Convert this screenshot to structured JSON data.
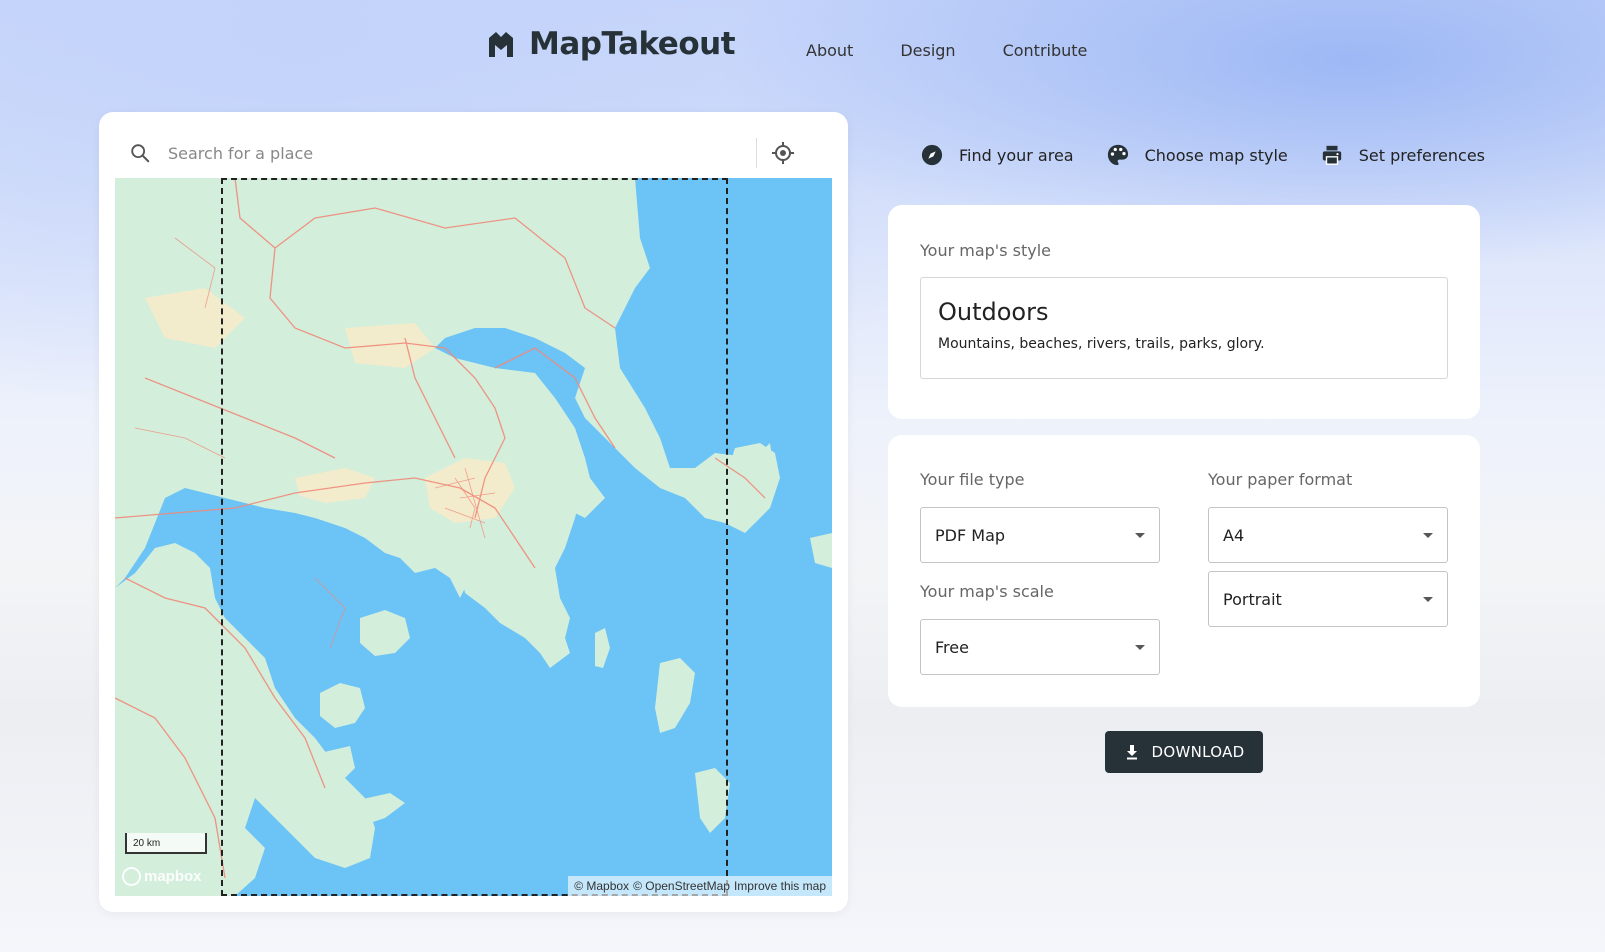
{
  "app": {
    "name": "MapTakeout"
  },
  "nav": [
    {
      "label": "About"
    },
    {
      "label": "Design"
    },
    {
      "label": "Contribute"
    }
  ],
  "search": {
    "placeholder": "Search for a place",
    "value": ""
  },
  "map": {
    "scale_label": "20 km",
    "provider_logo": "mapbox",
    "attribution": [
      "© Mapbox",
      "© OpenStreetMap",
      "Improve this map"
    ]
  },
  "steps": [
    {
      "label": "Find your area",
      "icon": "compass-icon"
    },
    {
      "label": "Choose map style",
      "icon": "palette-icon"
    },
    {
      "label": "Set preferences",
      "icon": "printer-icon"
    }
  ],
  "style_card": {
    "label": "Your map's style",
    "style_name": "Outdoors",
    "style_description": "Mountains, beaches, rivers, trails, parks, glory."
  },
  "options": {
    "file_type_label": "Your file type",
    "file_type_value": "PDF Map",
    "scale_label": "Your map's scale",
    "scale_value": "Free",
    "paper_format_label": "Your paper format",
    "paper_format_value": "A4",
    "orientation_value": "Portrait"
  },
  "download": {
    "label": "DOWNLOAD"
  },
  "colors": {
    "water": "#6bc3f6",
    "land": "#d3eedb",
    "urban": "#f3eccc",
    "roads": "#f08a7a",
    "button": "#263238"
  }
}
